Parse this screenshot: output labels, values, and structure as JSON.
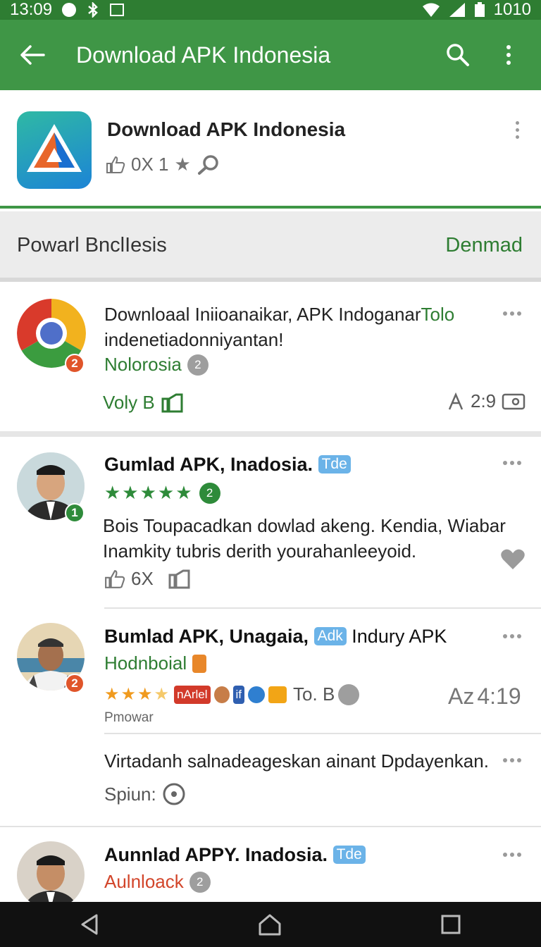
{
  "status_bar": {
    "time": "13:09",
    "right_text": "1010"
  },
  "app_bar": {
    "title": "Download APK Indonesia"
  },
  "app_card": {
    "name": "Download APK Indonesia",
    "meta": "0X 1"
  },
  "section": {
    "label": "Powarl BnclIesis",
    "action": "Denmad"
  },
  "items": [
    {
      "badge": "2",
      "title_line1": "Downloaal Iniioanaikar, APK",
      "title_line1b": " Indoganar",
      "title_link": "Tolo",
      "title_line2": "indenetiadonniyantan!",
      "subtitle": "Nolorosia",
      "subtitle_badge": "2",
      "footer_left": "Voly B",
      "footer_right": "2:9"
    },
    {
      "badge": "1",
      "title": "Gumlad APK, Inadosia.",
      "tag": "Tde",
      "rating_badge": "2",
      "body_line1": "Bois Toupacadkan dowlad akeng. Kendia, Wiabar",
      "body_line2": "Inamkity tubris derith yourahanleeyoid.",
      "count": "6X"
    },
    {
      "badge": "2",
      "title": "Bumlad APK, Unagaia,",
      "tag": "Adk",
      "title_tail": "Indury APK",
      "subtitle": "Hodnboial",
      "chip_text": "nArlel",
      "chip_tail": "To. B",
      "time": "4:19",
      "time_prefix": "Az",
      "caption": "Pmowar"
    },
    {
      "body": "Virtadanh salnadeageskan ainant Dpdayenkan.",
      "label": "Spiun:"
    },
    {
      "title": "Aunnlad APPY. Inadosia.",
      "tag": "Tde",
      "subtitle": "Aulnloack",
      "subtitle_badge": "2"
    }
  ]
}
